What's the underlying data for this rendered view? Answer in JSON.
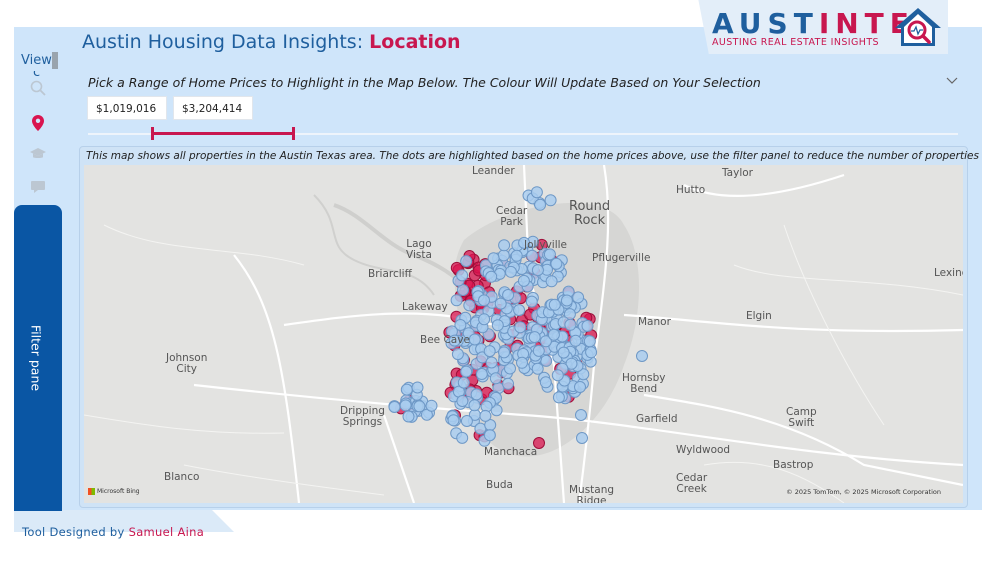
{
  "header": {
    "title_prefix": "Austin Housing Data Insights: ",
    "title_accent": "Location"
  },
  "logo": {
    "word_blue": "AUST",
    "word_red": "INTEL",
    "tagline": "AUSTING REAL ESTATE INSIGHTS"
  },
  "nav": {
    "view_label": "View",
    "icons": [
      "search-icon",
      "location-pin-icon",
      "graduation-cap-icon",
      "chat-icon"
    ]
  },
  "filter_pane": {
    "label": "Filter pane"
  },
  "slicer": {
    "title": "Pick a Range of Home Prices to Highlight in the Map Below. The Colour Will Update Based on Your Selection",
    "min_value": "$1,019,016",
    "max_value": "$3,204,414"
  },
  "map": {
    "caption": "This map shows all properties in the Austin Texas area. The dots are highlighted based on the home prices above, use the filter panel to reduce the number of properties",
    "places": {
      "leander": "Leander",
      "hutto": "Hutto",
      "taylor": "Taylor",
      "cedar_park": "Cedar\nPark",
      "round_rock": "Round\nRock",
      "jollyville": "Jollyville",
      "pflugerville": "Pflugerville",
      "lago_vista": "Lago\nVista",
      "briarcliff": "Briarcliff",
      "lakeway": "Lakeway",
      "bee_cave": "Bee Cave",
      "manor": "Manor",
      "elgin": "Elgin",
      "lexington": "Lexing",
      "johnson_city": "Johnson\nCity",
      "hornsby_bend": "Hornsby\nBend",
      "garfield": "Garfield",
      "camp_swift": "Camp\nSwift",
      "dripping_springs": "Dripping\nSprings",
      "wyldwood": "Wyldwood",
      "bastrop": "Bastrop",
      "manchaca": "Manchaca",
      "blanco": "Blanco",
      "buda": "Buda",
      "mustang_ridge": "Mustang\nRidge",
      "cedar_creek": "Cedar\nCreek"
    },
    "provider": "Microsoft Bing",
    "copyright": "© 2025 TomTom, © 2025 Microsoft Corporation",
    "colors": {
      "highlight": "#d9144f",
      "default": "#a9cdef",
      "outline": "#6e98c6"
    }
  },
  "footer": {
    "credit_prefix": "Tool Designed by ",
    "credit_name": "Samuel Aina"
  },
  "colors": {
    "brand_blue": "#1f5f9e",
    "brand_red": "#c8174f",
    "filter_pane": "#0a56a4"
  }
}
